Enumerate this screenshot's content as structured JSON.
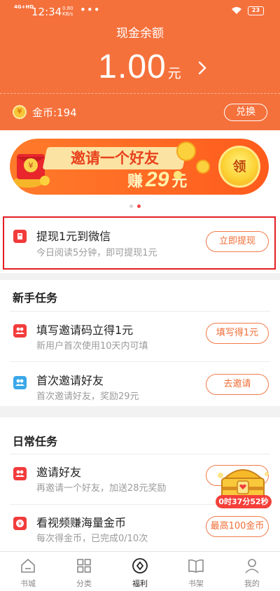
{
  "status_bar": {
    "network": "4G+HD",
    "time": "12:34",
    "speed_value": "0.80",
    "speed_unit": "KB/s",
    "dots": "•••",
    "battery": "23"
  },
  "header": {
    "title": "现金余额",
    "amount": "1.00",
    "unit": "元",
    "coins_label": "金币:194",
    "exchange_button": "兑换"
  },
  "banner": {
    "headline": "邀请一个好友",
    "prefix": "赚",
    "amount": "29",
    "suffix": "元",
    "claim_button": "领",
    "page_count": 2,
    "active_page": 2
  },
  "withdraw": {
    "title": "提现1元到微信",
    "subtitle": "今日阅读5分钟，即可提现1元",
    "button": "立即提现"
  },
  "newbie_tasks": {
    "title": "新手任务",
    "items": [
      {
        "title": "填写邀请码立得1元",
        "subtitle": "新用户首次使用10天内可填",
        "button": "填写得1元",
        "icon": "people-icon"
      },
      {
        "title": "首次邀请好友",
        "subtitle": "首次邀请好友，奖励29元",
        "button": "去邀请",
        "icon": "people-icon"
      }
    ]
  },
  "daily_tasks": {
    "title": "日常任务",
    "items": [
      {
        "title": "邀请好友",
        "subtitle": "再邀请一个好友，加送28元奖励",
        "button": "",
        "icon": "people-icon"
      },
      {
        "title": "看视频赚海量金币",
        "subtitle": "每次得金币，已完成0/10次",
        "button": "最高100金币",
        "icon": "yen-coin-icon"
      }
    ]
  },
  "treasure_timer": "0时37分52秒",
  "bottom_nav": [
    {
      "label": "书城",
      "icon": "home-icon",
      "active": false
    },
    {
      "label": "分类",
      "icon": "grid-icon",
      "active": false
    },
    {
      "label": "福利",
      "icon": "welfare-icon",
      "active": true
    },
    {
      "label": "书架",
      "icon": "book-icon",
      "active": false
    },
    {
      "label": "我的",
      "icon": "profile-icon",
      "active": false
    }
  ],
  "colors": {
    "header_bg": "#f5713c",
    "accent": "#f06d36",
    "highlight_border": "#e31e24",
    "icon_red": "#f23b3b",
    "icon_blue": "#3aa7e9"
  }
}
